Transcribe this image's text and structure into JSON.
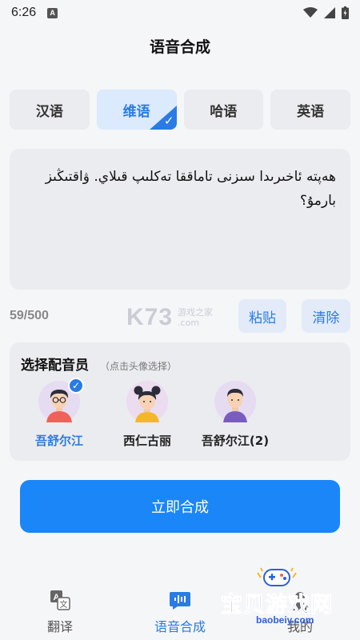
{
  "status_bar": {
    "time": "6:26",
    "notif_glyph": "A"
  },
  "header": {
    "title": "语音合成"
  },
  "languages": [
    {
      "label": "汉语",
      "active": false
    },
    {
      "label": "维语",
      "active": true
    },
    {
      "label": "哈语",
      "active": false
    },
    {
      "label": "英语",
      "active": false
    }
  ],
  "input": {
    "text": "ھەپتە  ئاخىرىدا سىزنى تاماققا تەكلىپ قىلاي. ۋاقتىڭىز بارمۇ؟",
    "counter": "59/500"
  },
  "actions": {
    "paste": "粘贴",
    "clear": "清除"
  },
  "voice_section": {
    "title": "选择配音员",
    "hint": "（点击头像选择）",
    "voices": [
      {
        "name": "吾舒尔江",
        "selected": true
      },
      {
        "name": "西仁古丽",
        "selected": false
      },
      {
        "name": "吾舒尔江(2)",
        "selected": false
      }
    ]
  },
  "synthesize_button": "立即合成",
  "nav": [
    {
      "label": "翻译",
      "icon": "translate-icon",
      "active": false
    },
    {
      "label": "语音合成",
      "icon": "voice-wave-icon",
      "active": true
    },
    {
      "label": "我的",
      "icon": "user-icon",
      "active": false
    }
  ],
  "watermarks": {
    "k73_big": "K73",
    "k73_small_1": "游戏之家",
    "k73_small_2": ".com",
    "baobei_title": "宝贝游戏网",
    "baobei_url": "baobeiy.com"
  },
  "colors": {
    "accent": "#2a7be4",
    "button": "#1b86f7",
    "card_bg": "#ebecef"
  }
}
